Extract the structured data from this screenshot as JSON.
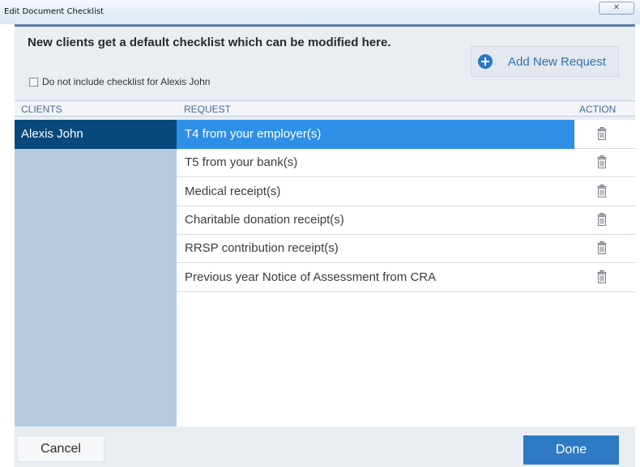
{
  "window": {
    "title": "Edit Document Checklist",
    "close_symbol": "☒"
  },
  "header": {
    "message": "New clients get a default checklist which can be modified here.",
    "add_button_label": "Add New Request",
    "add_icon": "plus-circle-icon",
    "opt_out_label": "Do not include checklist for Alexis John",
    "opt_out_checked": false
  },
  "table": {
    "columns": {
      "clients": "CLIENTS",
      "request": "REQUEST",
      "action": "ACTION"
    },
    "clients": [
      "Alexis John"
    ],
    "selected_client": "Alexis John",
    "requests": [
      "T4 from your employer(s)",
      "T5 from your bank(s)",
      "Medical receipt(s)",
      "Charitable donation receipt(s)",
      "RRSP contribution receipt(s)",
      "Previous year Notice of Assessment from CRA"
    ],
    "selected_request_index": 0,
    "action_icon": "trash-icon"
  },
  "footer": {
    "cancel_label": "Cancel",
    "done_label": "Done"
  },
  "colors": {
    "selected_client_bg": "#07497a",
    "selected_request_bg": "#2f8fe6",
    "clients_panel_bg": "#b4cbe2",
    "accent": "#2f7ac4"
  }
}
